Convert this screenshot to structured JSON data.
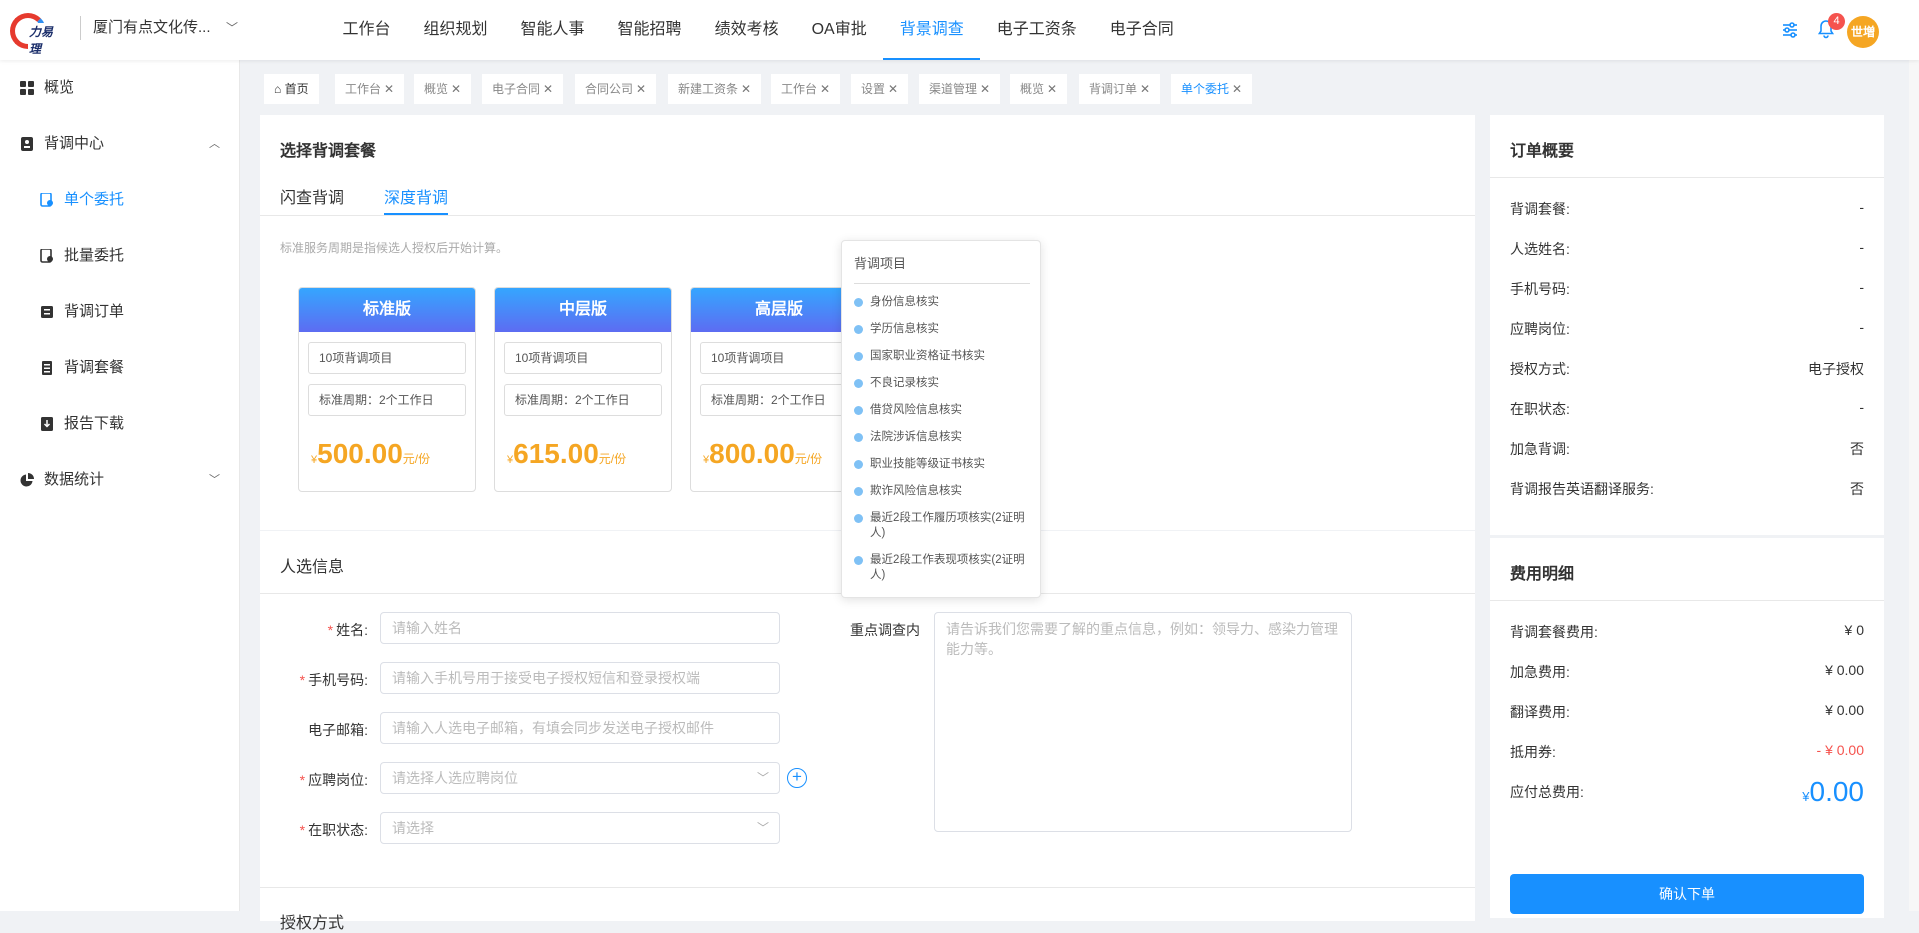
{
  "header": {
    "company": "厦门有点文化传...",
    "nav": [
      "工作台",
      "组织规划",
      "智能人事",
      "智能招聘",
      "绩效考核",
      "OA审批",
      "背景调查",
      "电子工资条",
      "电子合同"
    ],
    "active_nav": "背景调查",
    "notification_count": "4",
    "avatar_text": "世増",
    "accent": "#1890ff"
  },
  "sidebar": {
    "items": [
      {
        "label": "概览",
        "icon": "grid-icon"
      },
      {
        "label": "背调中心",
        "icon": "person-card-icon"
      },
      {
        "label": "单个委托",
        "icon": "user-doc-icon"
      },
      {
        "label": "批量委托",
        "icon": "users-doc-icon"
      },
      {
        "label": "背调订单",
        "icon": "order-icon"
      },
      {
        "label": "背调套餐",
        "icon": "package-icon"
      },
      {
        "label": "报告下载",
        "icon": "download-icon"
      },
      {
        "label": "数据统计",
        "icon": "pie-icon"
      }
    ]
  },
  "tabs": [
    "首页",
    "工作台",
    "概览",
    "电子合同",
    "合同公司",
    "新建工资条",
    "工作台",
    "设置",
    "渠道管理",
    "概览",
    "背调订单",
    "单个委托"
  ],
  "package": {
    "title": "选择背调套餐",
    "subtabs": [
      "闪查背调",
      "深度背调"
    ],
    "note": "标准服务周期是指候选人授权后开始计算。",
    "cards": [
      {
        "name": "标准版",
        "items": "10项背调项目",
        "period": "标准周期：2个工作日",
        "currency": "¥",
        "price": "500.00",
        "unit": "元/份"
      },
      {
        "name": "中层版",
        "items": "10项背调项目",
        "period": "标准周期：2个工作日",
        "currency": "¥",
        "price": "615.00",
        "unit": "元/份"
      },
      {
        "name": "高层版",
        "items": "10项背调项目",
        "period": "标准周期：2个工作日",
        "currency": "¥",
        "price": "800.00",
        "unit": "元/份"
      }
    ]
  },
  "popover": {
    "title": "背调项目",
    "items": [
      "身份信息核实",
      "学历信息核实",
      "国家职业资格证书核实",
      "不良记录核实",
      "借贷风险信息核实",
      "法院涉诉信息核实",
      "职业技能等级证书核实",
      "欺诈风险信息核实",
      "最近2段工作履历项核实(2证明人)",
      "最近2段工作表现项核实(2证明人)"
    ]
  },
  "candidate": {
    "title": "人选信息",
    "name_label": "姓名:",
    "name_ph": "请输入姓名",
    "phone_label": "手机号码:",
    "phone_ph": "请输入手机号用于接受电子授权短信和登录授权端",
    "email_label": "电子邮箱:",
    "email_ph": "请输入人选电子邮箱，有填会同步发送电子授权邮件",
    "position_label": "应聘岗位:",
    "position_ph": "请选择人选应聘岗位",
    "status_label": "在职状态:",
    "status_ph": "请选择",
    "focus_label": "重点调查内",
    "focus_ph": "请告诉我们您需要了解的重点信息，例如：领导力、感染力管理能力等。",
    "next_section": "授权方式"
  },
  "order": {
    "title": "订单概要",
    "rows": [
      {
        "k": "背调套餐:",
        "v": "-"
      },
      {
        "k": "人选姓名:",
        "v": "-"
      },
      {
        "k": "手机号码:",
        "v": "-"
      },
      {
        "k": "应聘岗位:",
        "v": "-"
      },
      {
        "k": "授权方式:",
        "v": "电子授权"
      },
      {
        "k": "在职状态:",
        "v": "-"
      },
      {
        "k": "加急背调:",
        "v": "否"
      },
      {
        "k": "背调报告英语翻译服务:",
        "v": "否"
      }
    ]
  },
  "fees": {
    "title": "费用明细",
    "rows": [
      {
        "k": "背调套餐费用:",
        "v": "¥ 0"
      },
      {
        "k": "加急费用:",
        "v": "¥ 0.00"
      },
      {
        "k": "翻译费用:",
        "v": "¥ 0.00"
      },
      {
        "k": "抵用券:",
        "v": "- ¥ 0.00"
      }
    ],
    "total_label": "应付总费用:",
    "total_currency": "¥",
    "total": "0.00",
    "confirm": "确认下单"
  }
}
